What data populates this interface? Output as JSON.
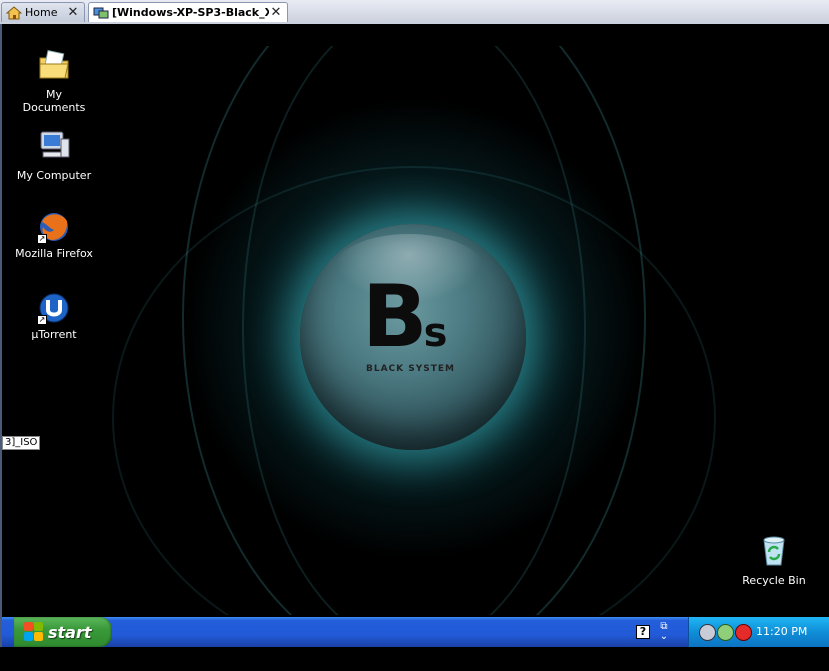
{
  "tabs": [
    {
      "label": "Home",
      "icon": "home-icon",
      "close_label": "✕"
    },
    {
      "label": "[Windows-XP-SP3-Black_X...",
      "icon": "vm-icon",
      "close_label": "✕"
    }
  ],
  "desktop": {
    "icons": [
      {
        "label": "My Documents",
        "icon": "my-documents-icon"
      },
      {
        "label": "My Computer",
        "icon": "my-computer-icon"
      },
      {
        "label": "Mozilla Firefox",
        "icon": "firefox-icon",
        "shortcut": true
      },
      {
        "label": "µTorrent",
        "icon": "utorrent-icon",
        "shortcut": true
      },
      {
        "label": "Recycle Bin",
        "icon": "recycle-bin-icon"
      }
    ],
    "partial_label": "3]_ISO",
    "wallpaper": {
      "logo_main": "B",
      "logo_small": "s",
      "logo_sub": "BLACK SYSTEM"
    }
  },
  "taskbar": {
    "start_label": "start",
    "help_label": "?",
    "clock": "11:20 PM"
  },
  "colors": {
    "taskbar_blue": "#245edb",
    "start_green": "#3a9a3a",
    "tray_blue": "#0f8ed8",
    "glow_teal": "#3cbec8"
  }
}
